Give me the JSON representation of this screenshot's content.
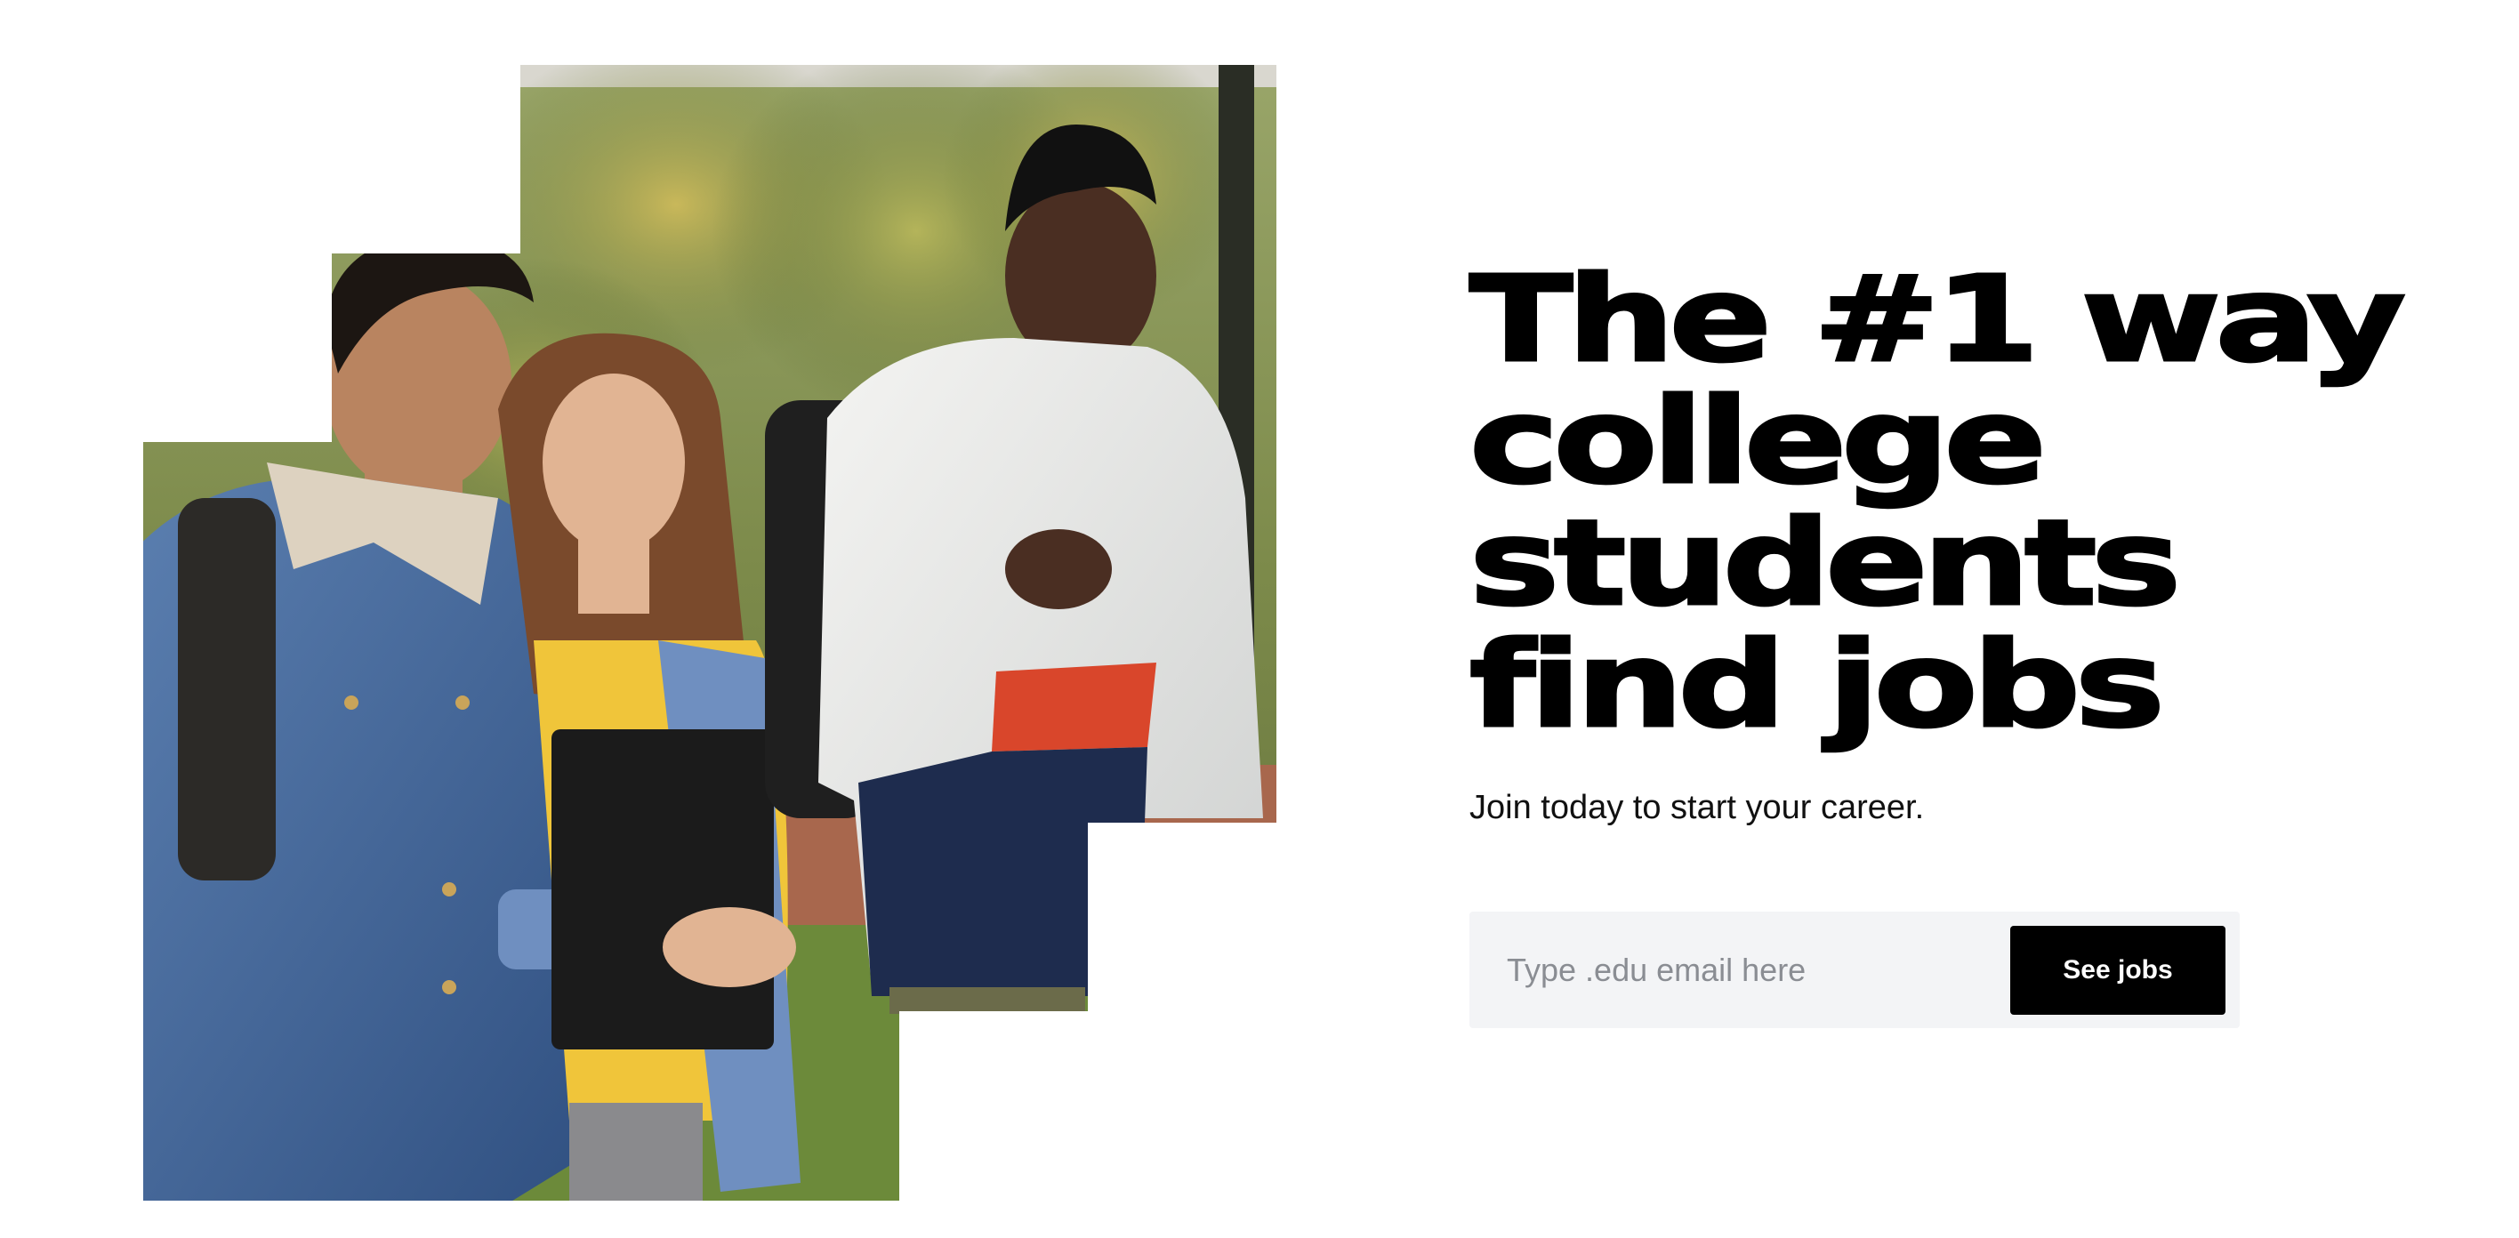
{
  "hero": {
    "title_lines": [
      "The #1 way",
      "college",
      "students",
      "find jobs"
    ],
    "subtitle": "Join today to start your career."
  },
  "signup": {
    "email_placeholder": "Type .edu email here",
    "email_value": "",
    "submit_label": "See jobs"
  },
  "photo": {
    "description_icon": "students-walking-photo"
  },
  "colors": {
    "background": "#ffffff",
    "text": "#000000",
    "button_bg": "#000000",
    "button_text": "#ffffff",
    "input_bg": "#f3f4f6",
    "placeholder": "#8a8d93"
  }
}
